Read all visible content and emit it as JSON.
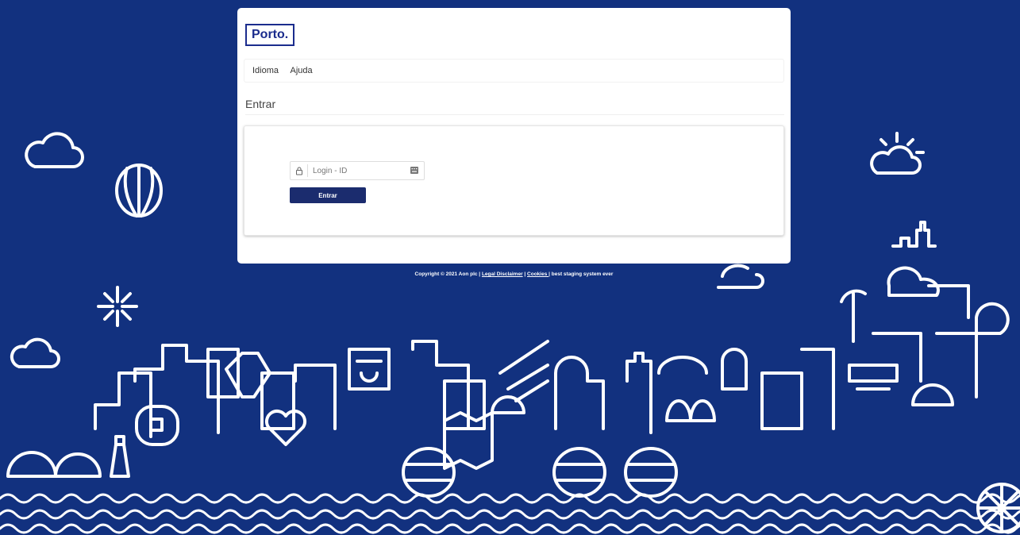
{
  "brand": {
    "logo_text": "Porto."
  },
  "nav": {
    "items": [
      "Idioma",
      "Ajuda"
    ]
  },
  "page": {
    "title": "Entrar"
  },
  "login": {
    "placeholder": "Login - ID",
    "value": "",
    "submit_label": "Entrar"
  },
  "footer": {
    "copyright": "Copyright © 2021 Aon plc | ",
    "legal_link": "Legal Disclaimer",
    "separator": " | ",
    "cookies_link": "Cookies ",
    "suffix": "| best staging system ever"
  },
  "icons": {
    "lock": "lock-icon",
    "keyboard": "keyboard-icon"
  },
  "colors": {
    "background": "#12317f",
    "brand_blue": "#1b2c8d",
    "button": "#1b2c6e",
    "card": "#ffffff"
  }
}
